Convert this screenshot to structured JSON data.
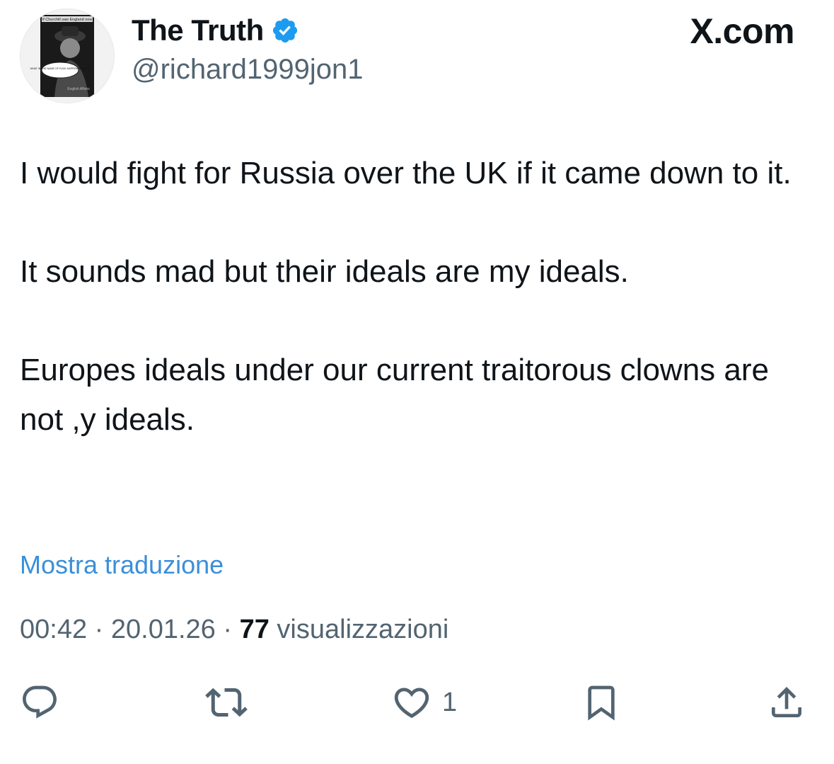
{
  "author": {
    "display_name": "The Truth",
    "handle": "@richard1999jon1",
    "verified_icon": "verified-badge-icon",
    "avatar_caption": "If Churchill saw England now",
    "avatar_bubble": "WHAT IN THE NAME OF FUCK HAPPENED HERE?",
    "avatar_footer": "English Affairs"
  },
  "brand": {
    "label": "X.com"
  },
  "tweet": {
    "paragraphs": [
      "I would fight for Russia over the UK if it came down to it.",
      "It sounds mad but their ideals are my ideals.",
      "Europes ideals under our current traitorous clowns are not ,y ideals."
    ],
    "translate_label": "Mostra traduzione"
  },
  "meta": {
    "time": "00:42",
    "separator": " · ",
    "date": "20.01.26",
    "views_count": "77",
    "views_label": " visualizzazioni"
  },
  "actions": {
    "reply_icon": "reply-icon",
    "retweet_icon": "retweet-icon",
    "like_icon": "heart-icon",
    "like_count": "1",
    "bookmark_icon": "bookmark-icon",
    "share_icon": "share-icon"
  },
  "colors": {
    "link": "#3b8fd9",
    "muted": "#536471",
    "text": "#0f1419",
    "verified": "#1d9bf0"
  }
}
